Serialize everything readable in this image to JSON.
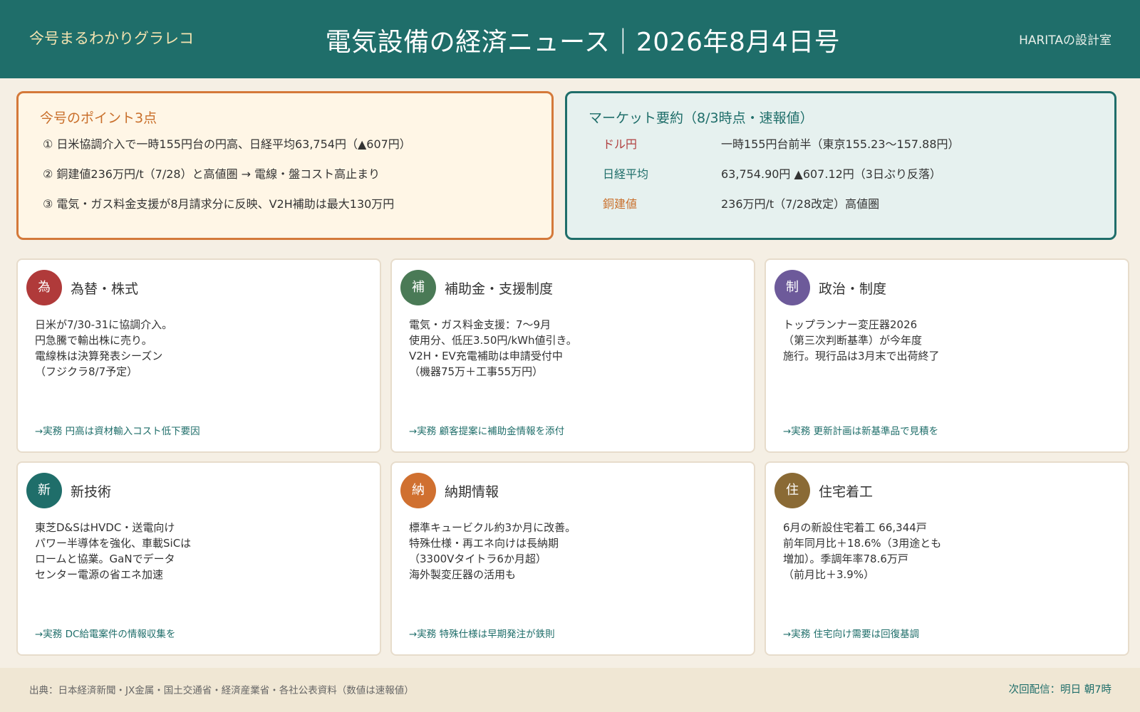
{
  "header": {
    "left_label": "今号まるわかりグラレコ",
    "title": "電気設備の経済ニュース｜2026年8月4日号",
    "right_label": "HARITAの設計室"
  },
  "points": {
    "heading": "今号のポイント3点",
    "items": [
      "① 日米協調介入で一時155円台の円高、日経平均63,754円（▲607円）",
      "② 銅建値236万円/t（7/28）と高値圏 → 電線・盤コスト高止まり",
      "③ 電気・ガス料金支援が8月請求分に反映、V2H補助は最大130万円"
    ]
  },
  "market": {
    "heading": "マーケット要約（8/3時点・速報値）",
    "rows": [
      {
        "label": "ドル円",
        "value": "一時155円台前半（東京155.23〜157.88円）",
        "color": "#b04040"
      },
      {
        "label": "日経平均",
        "value": "63,754.90円 ▲607.12円（3日ぶり反落）",
        "color": "#1f6e6a"
      },
      {
        "label": "銅建値",
        "value": "236万円/t（7/28改定）高値圏",
        "color": "#c96f2b"
      }
    ]
  },
  "cards": [
    {
      "badge": "為",
      "color": "#b03a3a",
      "title": "為替・株式",
      "lines": [
        "日米が7/30-31に協調介入。",
        "円急騰で輸出株に売り。",
        "電線株は決算発表シーズン",
        "（フジクラ8/7予定）"
      ],
      "action": "→実務 円高は資材輸入コスト低下要因"
    },
    {
      "badge": "補",
      "color": "#4a7a56",
      "title": "補助金・支援制度",
      "lines": [
        "電気・ガス料金支援：7〜9月",
        "使用分、低圧3.50円/kWh値引き。",
        "V2H・EV充電補助は申請受付中",
        "（機器75万＋工事55万円）"
      ],
      "action": "→実務 顧客提案に補助金情報を添付"
    },
    {
      "badge": "制",
      "color": "#6d5a9a",
      "title": "政治・制度",
      "lines": [
        "トップランナー変圧器2026",
        "（第三次判断基準）が今年度",
        "施行。現行品は3月末で出荷終了"
      ],
      "action": "→実務 更新計画は新基準品で見積を"
    },
    {
      "badge": "新",
      "color": "#1f6e6a",
      "title": "新技術",
      "lines": [
        "東芝D&SはHVDC・送電向け",
        "パワー半導体を強化、車載SiCは",
        "ロームと協業。GaNでデータ",
        "センター電源の省エネ加速"
      ],
      "action": "→実務 DC給電案件の情報収集を"
    },
    {
      "badge": "納",
      "color": "#d07030",
      "title": "納期情報",
      "lines": [
        "標準キュービクル約3か月に改善。",
        "特殊仕様・再エネ向けは長納期",
        "（3300Vタイトラ6か月超）",
        "海外製変圧器の活用も"
      ],
      "action": "→実務 特殊仕様は早期発注が鉄則"
    },
    {
      "badge": "住",
      "color": "#8a6a35",
      "title": "住宅着工",
      "lines": [
        "6月の新設住宅着工 66,344戸",
        "前年同月比＋18.6%（3用途とも",
        "増加）。季調年率78.6万戸",
        "（前月比＋3.9%）"
      ],
      "action": "→実務 住宅向け需要は回復基調"
    }
  ],
  "footer": {
    "source": "出典：日本経済新聞・JX金属・国土交通省・経済産業省・各社公表資料（数値は速報値）",
    "next": "次回配信：明日 朝7時"
  }
}
